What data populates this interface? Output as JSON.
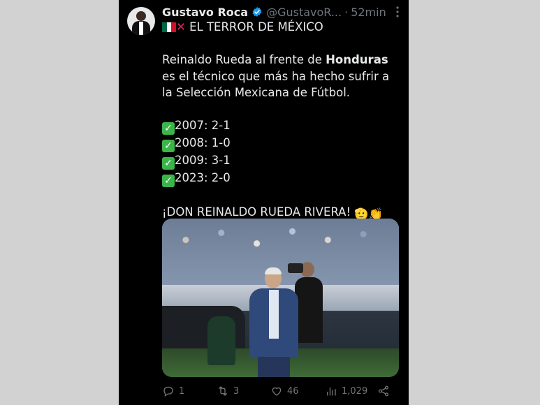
{
  "author": {
    "name": "Gustavo Roca",
    "handle": "@GustavoR...",
    "separator": "·",
    "time": "52min",
    "more_icon": "more-vertical-icon"
  },
  "tweet": {
    "headline": "EL TERROR DE MÉXICO",
    "intro_before": "Reinaldo Rueda al frente de ",
    "intro_bold": "Honduras",
    "intro_after": " es el técnico que más ha hecho sufrir a la Selección Mexicana de Fútbol.",
    "results": [
      "2007: 2-1",
      "2008: 1-0",
      "2009: 3-1",
      "2023: 2-0"
    ],
    "closing": "¡DON REINALDO RUEDA RIVERA!",
    "closing_emojis": "🫡👏"
  },
  "actions": {
    "replies": "1",
    "retweets": "3",
    "likes": "46",
    "views": "1,029"
  },
  "colors": {
    "background": "#000000",
    "text": "#e7e9ea",
    "muted": "#71767b",
    "verified": "#1d9bf0",
    "check_green": "#3bb54a"
  }
}
